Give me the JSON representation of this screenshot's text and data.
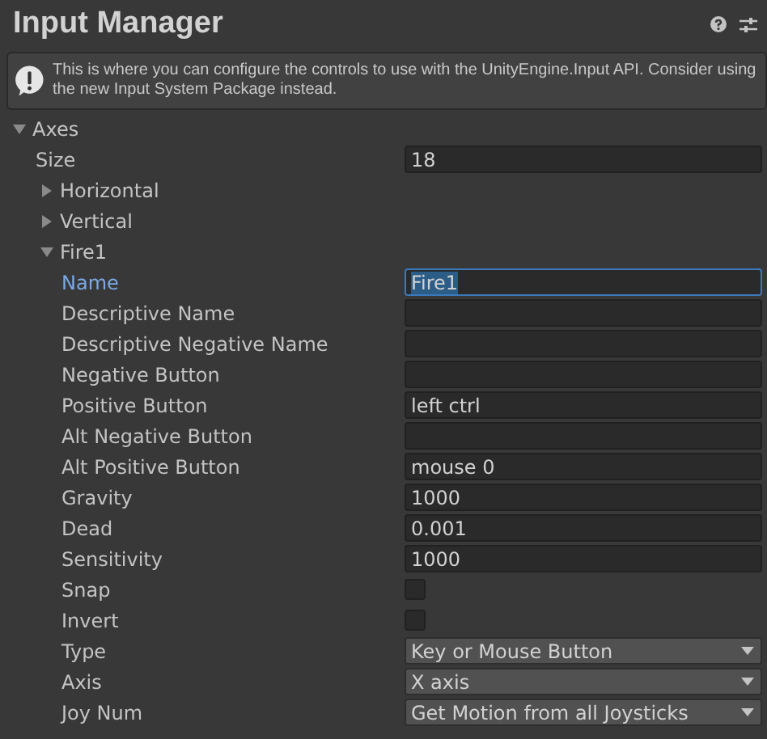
{
  "title": "Input Manager",
  "help_box": {
    "text": "This is where you can configure the controls to use with the UnityEngine.Input API. Consider using the new Input System Package instead."
  },
  "axes": {
    "label": "Axes",
    "expanded": true,
    "size": {
      "label": "Size",
      "value": "18"
    },
    "items": [
      {
        "label": "Horizontal",
        "expanded": false
      },
      {
        "label": "Vertical",
        "expanded": false
      },
      {
        "label": "Fire1",
        "expanded": true,
        "fields": [
          {
            "kind": "text",
            "label": "Name",
            "value": "Fire1",
            "focused": true
          },
          {
            "kind": "text",
            "label": "Descriptive Name",
            "focused": false
          },
          {
            "kind": "text",
            "label": "Descriptive Negative Name",
            "focused": false
          },
          {
            "kind": "text",
            "label": "Negative Button",
            "focused": false
          },
          {
            "kind": "text",
            "label": "Positive Button",
            "value": "left ctrl",
            "focused": false
          },
          {
            "kind": "text",
            "label": "Alt Negative Button",
            "focused": false
          },
          {
            "kind": "text",
            "label": "Alt Positive Button",
            "value": "mouse 0",
            "focused": false
          },
          {
            "kind": "text",
            "label": "Gravity",
            "value": "1000",
            "focused": false
          },
          {
            "kind": "text",
            "label": "Dead",
            "value": "0.001",
            "focused": false
          },
          {
            "kind": "text",
            "label": "Sensitivity",
            "value": "1000",
            "focused": false
          },
          {
            "kind": "checkbox",
            "label": "Snap",
            "checked": false
          },
          {
            "kind": "checkbox",
            "label": "Invert",
            "checked": false
          },
          {
            "kind": "dropdown",
            "label": "Type",
            "value": "Key or Mouse Button"
          },
          {
            "kind": "dropdown",
            "label": "Axis",
            "value": "X axis"
          },
          {
            "kind": "dropdown",
            "label": "Joy Num",
            "value": "Get Motion from all Joysticks"
          }
        ]
      }
    ]
  }
}
